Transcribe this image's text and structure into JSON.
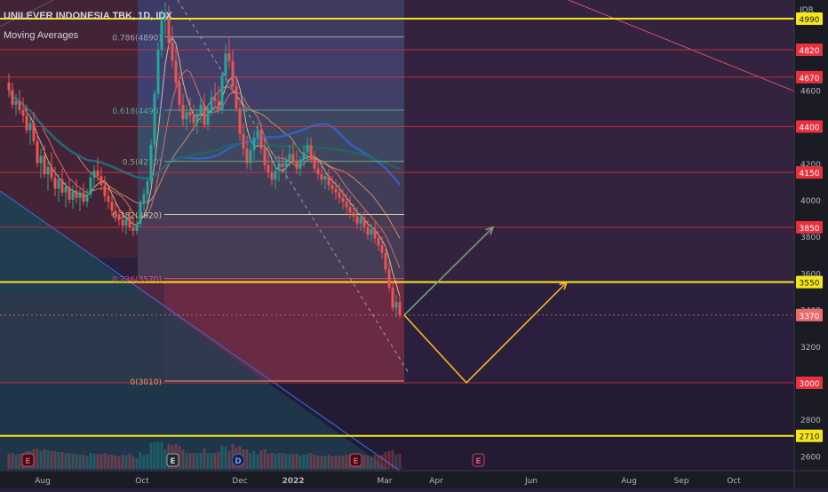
{
  "header": {
    "title": "UNILEVER INDONESIA TBK, 1D, IDX",
    "indicator": "Moving Averages"
  },
  "chart_data": {
    "type": "candlestick",
    "currency": "IDR",
    "x_tick_labels": [
      "Aug",
      "Oct",
      "Dec",
      "2022",
      "Mar",
      "Apr",
      "Jun",
      "Aug",
      "Sep",
      "Oct"
    ],
    "y_tick_labels": [
      "4600",
      "4400",
      "4200",
      "4000",
      "3800",
      "3600",
      "3400",
      "3200",
      "3000",
      "2800",
      "2600"
    ],
    "ylim": [
      2520,
      5090
    ],
    "price_levels": [
      {
        "label": "4990",
        "value": 4990,
        "color": "#f5e61b",
        "kind": "yellow-line"
      },
      {
        "label": "4820",
        "value": 4820,
        "color": "#e8303f",
        "kind": "red-line"
      },
      {
        "label": "4670",
        "value": 4670,
        "color": "#e8303f",
        "kind": "red-line"
      },
      {
        "label": "4400",
        "value": 4400,
        "color": "#e8303f",
        "kind": "red-line"
      },
      {
        "label": "4150",
        "value": 4150,
        "color": "#e8303f",
        "kind": "red-line"
      },
      {
        "label": "3850",
        "value": 3850,
        "color": "#e8303f",
        "kind": "red-line"
      },
      {
        "label": "3550",
        "value": 3550,
        "color": "#f5e61b",
        "kind": "yellow-line"
      },
      {
        "label": "3370",
        "value": 3370,
        "color": "#f06b6b",
        "kind": "last-price"
      },
      {
        "label": "3000",
        "value": 3000,
        "color": "#e8303f",
        "kind": "red-line"
      },
      {
        "label": "2710",
        "value": 2710,
        "color": "#f5e61b",
        "kind": "yellow-line"
      }
    ],
    "fibonacci": [
      {
        "label": "0.786(4890)",
        "value": 4890
      },
      {
        "label": "0.618(4490)",
        "value": 4490
      },
      {
        "label": "0.5(4210)",
        "value": 4210
      },
      {
        "label": "0.382(3920)",
        "value": 3920
      },
      {
        "label": "0.236(3570)",
        "value": 3570
      },
      {
        "label": "0(3010)",
        "value": 3010
      }
    ],
    "projections": [
      {
        "name": "bull",
        "color": "#7a9e7e",
        "points": [
          [
            455,
            3370
          ],
          [
            555,
            3850
          ]
        ]
      },
      {
        "name": "path",
        "color": "#f5b61b",
        "points": [
          [
            455,
            3370
          ],
          [
            525,
            3000
          ],
          [
            638,
            3550
          ]
        ]
      }
    ],
    "candles": [
      [
        10,
        4640,
        4690,
        4560,
        4600
      ],
      [
        14,
        4600,
        4640,
        4500,
        4520
      ],
      [
        18,
        4520,
        4580,
        4460,
        4540
      ],
      [
        22,
        4540,
        4600,
        4470,
        4490
      ],
      [
        26,
        4490,
        4560,
        4420,
        4460
      ],
      [
        30,
        4460,
        4520,
        4360,
        4380
      ],
      [
        34,
        4380,
        4460,
        4300,
        4420
      ],
      [
        38,
        4420,
        4480,
        4300,
        4320
      ],
      [
        42,
        4320,
        4370,
        4180,
        4200
      ],
      [
        46,
        4200,
        4280,
        4120,
        4240
      ],
      [
        50,
        4240,
        4300,
        4120,
        4140
      ],
      [
        54,
        4140,
        4220,
        4050,
        4180
      ],
      [
        58,
        4180,
        4260,
        4100,
        4120
      ],
      [
        62,
        4120,
        4180,
        4020,
        4060
      ],
      [
        66,
        4060,
        4140,
        3990,
        4110
      ],
      [
        70,
        4110,
        4170,
        4020,
        4040
      ],
      [
        74,
        4040,
        4100,
        3960,
        4070
      ],
      [
        78,
        4070,
        4120,
        3980,
        4000
      ],
      [
        82,
        4000,
        4080,
        3950,
        4050
      ],
      [
        86,
        4050,
        4110,
        3980,
        4010
      ],
      [
        90,
        4010,
        4060,
        3940,
        4040
      ],
      [
        94,
        4040,
        4090,
        3970,
        3990
      ],
      [
        98,
        3990,
        4060,
        3960,
        4030
      ],
      [
        102,
        4030,
        4150,
        4010,
        4120
      ],
      [
        106,
        4120,
        4190,
        4060,
        4160
      ],
      [
        110,
        4160,
        4230,
        4100,
        4130
      ],
      [
        114,
        4130,
        4180,
        4050,
        4080
      ],
      [
        118,
        4080,
        4130,
        3990,
        4020
      ],
      [
        122,
        4020,
        4070,
        3950,
        3990
      ],
      [
        126,
        3990,
        4030,
        3910,
        3940
      ],
      [
        130,
        3940,
        3990,
        3880,
        3920
      ],
      [
        134,
        3920,
        3960,
        3860,
        3890
      ],
      [
        138,
        3890,
        3940,
        3820,
        3860
      ],
      [
        142,
        3860,
        3920,
        3810,
        3900
      ],
      [
        146,
        3900,
        3960,
        3830,
        3850
      ],
      [
        150,
        3850,
        3900,
        3800,
        3830
      ],
      [
        154,
        3830,
        3890,
        3810,
        3870
      ],
      [
        158,
        3870,
        4000,
        3850,
        3980
      ],
      [
        162,
        3980,
        4060,
        3940,
        4030
      ],
      [
        166,
        4030,
        4120,
        3990,
        4100
      ],
      [
        170,
        4100,
        4330,
        4080,
        4300
      ],
      [
        174,
        4300,
        4600,
        4280,
        4580
      ],
      [
        178,
        4580,
        4860,
        4550,
        4820
      ],
      [
        182,
        4820,
        5040,
        4780,
        4980
      ],
      [
        186,
        4980,
        5080,
        4900,
        5020
      ],
      [
        190,
        5020,
        5060,
        4820,
        4860
      ],
      [
        194,
        4860,
        4950,
        4720,
        4760
      ],
      [
        198,
        4760,
        4840,
        4600,
        4640
      ],
      [
        202,
        4640,
        4700,
        4480,
        4520
      ],
      [
        206,
        4520,
        4580,
        4400,
        4440
      ],
      [
        210,
        4440,
        4520,
        4380,
        4480
      ],
      [
        214,
        4480,
        4560,
        4420,
        4460
      ],
      [
        218,
        4460,
        4520,
        4380,
        4420
      ],
      [
        222,
        4420,
        4500,
        4360,
        4470
      ],
      [
        226,
        4470,
        4560,
        4420,
        4520
      ],
      [
        230,
        4520,
        4580,
        4390,
        4410
      ],
      [
        234,
        4410,
        4520,
        4380,
        4500
      ],
      [
        238,
        4500,
        4600,
        4460,
        4560
      ],
      [
        242,
        4560,
        4640,
        4500,
        4540
      ],
      [
        246,
        4540,
        4620,
        4470,
        4490
      ],
      [
        250,
        4490,
        4700,
        4470,
        4680
      ],
      [
        254,
        4680,
        4850,
        4640,
        4800
      ],
      [
        258,
        4800,
        4880,
        4720,
        4760
      ],
      [
        262,
        4760,
        4820,
        4580,
        4620
      ],
      [
        266,
        4620,
        4680,
        4480,
        4500
      ],
      [
        270,
        4500,
        4540,
        4320,
        4360
      ],
      [
        274,
        4360,
        4420,
        4240,
        4280
      ],
      [
        278,
        4280,
        4350,
        4170,
        4200
      ],
      [
        282,
        4200,
        4300,
        4160,
        4270
      ],
      [
        286,
        4270,
        4380,
        4220,
        4340
      ],
      [
        290,
        4340,
        4420,
        4300,
        4380
      ],
      [
        294,
        4380,
        4420,
        4250,
        4280
      ],
      [
        298,
        4280,
        4340,
        4160,
        4190
      ],
      [
        302,
        4190,
        4250,
        4120,
        4150
      ],
      [
        306,
        4150,
        4220,
        4080,
        4110
      ],
      [
        310,
        4110,
        4190,
        4060,
        4160
      ],
      [
        314,
        4160,
        4240,
        4100,
        4200
      ],
      [
        318,
        4200,
        4280,
        4140,
        4180
      ],
      [
        322,
        4180,
        4240,
        4110,
        4220
      ],
      [
        326,
        4220,
        4300,
        4180,
        4250
      ],
      [
        330,
        4250,
        4320,
        4190,
        4210
      ],
      [
        334,
        4210,
        4270,
        4140,
        4170
      ],
      [
        338,
        4170,
        4240,
        4130,
        4220
      ],
      [
        342,
        4220,
        4300,
        4180,
        4260
      ],
      [
        346,
        4260,
        4340,
        4210,
        4300
      ],
      [
        350,
        4300,
        4340,
        4200,
        4230
      ],
      [
        354,
        4230,
        4270,
        4150,
        4170
      ],
      [
        358,
        4170,
        4220,
        4110,
        4140
      ],
      [
        362,
        4140,
        4190,
        4080,
        4110
      ],
      [
        366,
        4110,
        4160,
        4060,
        4130
      ],
      [
        370,
        4130,
        4170,
        4050,
        4080
      ],
      [
        374,
        4080,
        4130,
        4030,
        4060
      ],
      [
        378,
        4060,
        4110,
        4000,
        4040
      ],
      [
        382,
        4040,
        4090,
        3980,
        4010
      ],
      [
        386,
        4010,
        4060,
        3950,
        3990
      ],
      [
        390,
        3990,
        4040,
        3920,
        3960
      ],
      [
        394,
        3960,
        4020,
        3900,
        3930
      ],
      [
        398,
        3930,
        3980,
        3880,
        3910
      ],
      [
        402,
        3910,
        3960,
        3840,
        3870
      ],
      [
        406,
        3870,
        3930,
        3830,
        3900
      ],
      [
        410,
        3900,
        3940,
        3820,
        3850
      ],
      [
        414,
        3850,
        3890,
        3780,
        3810
      ],
      [
        418,
        3810,
        3870,
        3770,
        3840
      ],
      [
        422,
        3840,
        3880,
        3760,
        3790
      ],
      [
        426,
        3790,
        3830,
        3720,
        3750
      ],
      [
        430,
        3750,
        3800,
        3680,
        3710
      ],
      [
        434,
        3710,
        3750,
        3600,
        3620
      ],
      [
        438,
        3620,
        3660,
        3500,
        3520
      ],
      [
        442,
        3520,
        3560,
        3390,
        3410
      ],
      [
        446,
        3410,
        3480,
        3360,
        3440
      ],
      [
        450,
        3440,
        3480,
        3350,
        3370
      ]
    ]
  }
}
